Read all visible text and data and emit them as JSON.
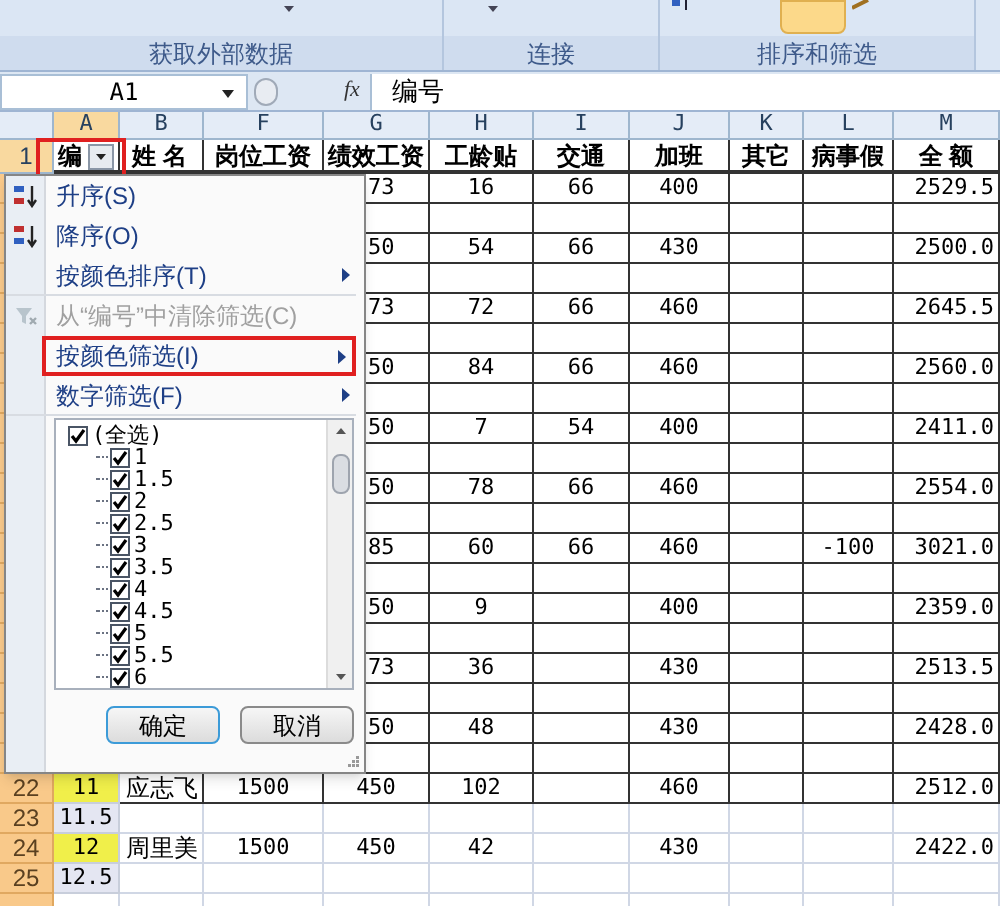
{
  "ribbon": {
    "groups": [
      {
        "label": "获取外部数据"
      },
      {
        "label": "连接"
      },
      {
        "label": "排序和筛选"
      }
    ]
  },
  "formula_bar": {
    "name_box": "A1",
    "function_label": "fx",
    "formula": "编号"
  },
  "columns": [
    {
      "letter": "A",
      "selected": true
    },
    {
      "letter": "B",
      "selected": false
    },
    {
      "letter": "F",
      "selected": false
    },
    {
      "letter": "G",
      "selected": false
    },
    {
      "letter": "H",
      "selected": false
    },
    {
      "letter": "I",
      "selected": false
    },
    {
      "letter": "J",
      "selected": false
    },
    {
      "letter": "K",
      "selected": false
    },
    {
      "letter": "L",
      "selected": false
    },
    {
      "letter": "M",
      "selected": false
    }
  ],
  "header_row": {
    "number": "1",
    "cells": {
      "A": "编",
      "B": "姓 名",
      "F": "岗位工资",
      "G": "绩效工资",
      "H": "工龄贴",
      "I": "交通",
      "J": "加班",
      "K": "其它",
      "L": "病事假",
      "M": "全 额"
    }
  },
  "rows": [
    {
      "cells": {
        "G": "73",
        "H": "16",
        "I": "66",
        "J": "400",
        "M": "2529.5"
      }
    },
    {
      "cells": {}
    },
    {
      "cells": {
        "G": "50",
        "H": "54",
        "I": "66",
        "J": "430",
        "M": "2500.0"
      }
    },
    {
      "cells": {}
    },
    {
      "cells": {
        "G": "73",
        "H": "72",
        "I": "66",
        "J": "460",
        "M": "2645.5"
      }
    },
    {
      "cells": {}
    },
    {
      "cells": {
        "G": "50",
        "H": "84",
        "I": "66",
        "J": "460",
        "M": "2560.0"
      }
    },
    {
      "cells": {}
    },
    {
      "cells": {
        "G": "50",
        "H": "7",
        "I": "54",
        "J": "400",
        "M": "2411.0"
      }
    },
    {
      "cells": {}
    },
    {
      "cells": {
        "G": "50",
        "H": "78",
        "I": "66",
        "J": "460",
        "M": "2554.0"
      }
    },
    {
      "cells": {}
    },
    {
      "cells": {
        "G": "85",
        "H": "60",
        "I": "66",
        "J": "460",
        "L": "-100",
        "M": "3021.0"
      }
    },
    {
      "cells": {}
    },
    {
      "cells": {
        "G": "50",
        "H": "9",
        "J": "400",
        "M": "2359.0"
      }
    },
    {
      "cells": {}
    },
    {
      "cells": {
        "G": "73",
        "H": "36",
        "J": "430",
        "M": "2513.5"
      }
    },
    {
      "cells": {}
    },
    {
      "cells": {
        "G": "50",
        "H": "48",
        "J": "430",
        "M": "2428.0"
      }
    },
    {
      "cells": {}
    },
    {
      "number": "22",
      "color": "#f0ef4a",
      "cells": {
        "A": "11",
        "B": "应志飞",
        "F": "1500",
        "G": "450",
        "H": "102",
        "J": "460",
        "M": "2512.0"
      }
    },
    {
      "number": "23",
      "color": "#e4e6f2",
      "cells": {
        "A": "11.5"
      }
    },
    {
      "number": "24",
      "color": "#f0ef4a",
      "cells": {
        "A": "12",
        "B": "周里美",
        "F": "1500",
        "G": "450",
        "H": "42",
        "J": "430",
        "M": "2422.0"
      }
    },
    {
      "number": "25",
      "color": "#e4e6f2",
      "cells": {
        "A": "12.5"
      }
    }
  ],
  "filter_menu": {
    "items": [
      {
        "label": "升序(S)",
        "disabled": false,
        "submenu": false,
        "highlighted": false,
        "separator_after": false
      },
      {
        "label": "降序(O)",
        "disabled": false,
        "submenu": false,
        "highlighted": false,
        "separator_after": false
      },
      {
        "label": "按颜色排序(T)",
        "disabled": false,
        "submenu": true,
        "highlighted": false,
        "separator_after": true
      },
      {
        "label": "从“编号”中清除筛选(C)",
        "disabled": true,
        "submenu": false,
        "highlighted": false,
        "separator_after": false
      },
      {
        "label": "按颜色筛选(I)",
        "disabled": false,
        "submenu": true,
        "highlighted": true,
        "separator_after": false
      },
      {
        "label": "数字筛选(F)",
        "disabled": false,
        "submenu": true,
        "highlighted": false,
        "separator_after": true
      }
    ],
    "values": [
      {
        "label": "(全选)",
        "checked": true,
        "children": [
          {
            "label": "1",
            "checked": true
          },
          {
            "label": "1.5",
            "checked": true
          },
          {
            "label": "2",
            "checked": true
          },
          {
            "label": "2.5",
            "checked": true
          },
          {
            "label": "3",
            "checked": true
          },
          {
            "label": "3.5",
            "checked": true
          },
          {
            "label": "4",
            "checked": true
          },
          {
            "label": "4.5",
            "checked": true
          },
          {
            "label": "5",
            "checked": true
          },
          {
            "label": "5.5",
            "checked": true
          },
          {
            "label": "6",
            "checked": true
          }
        ]
      }
    ],
    "buttons": [
      {
        "label": "确定",
        "kind": "default"
      },
      {
        "label": "取消",
        "kind": "normal"
      }
    ]
  }
}
